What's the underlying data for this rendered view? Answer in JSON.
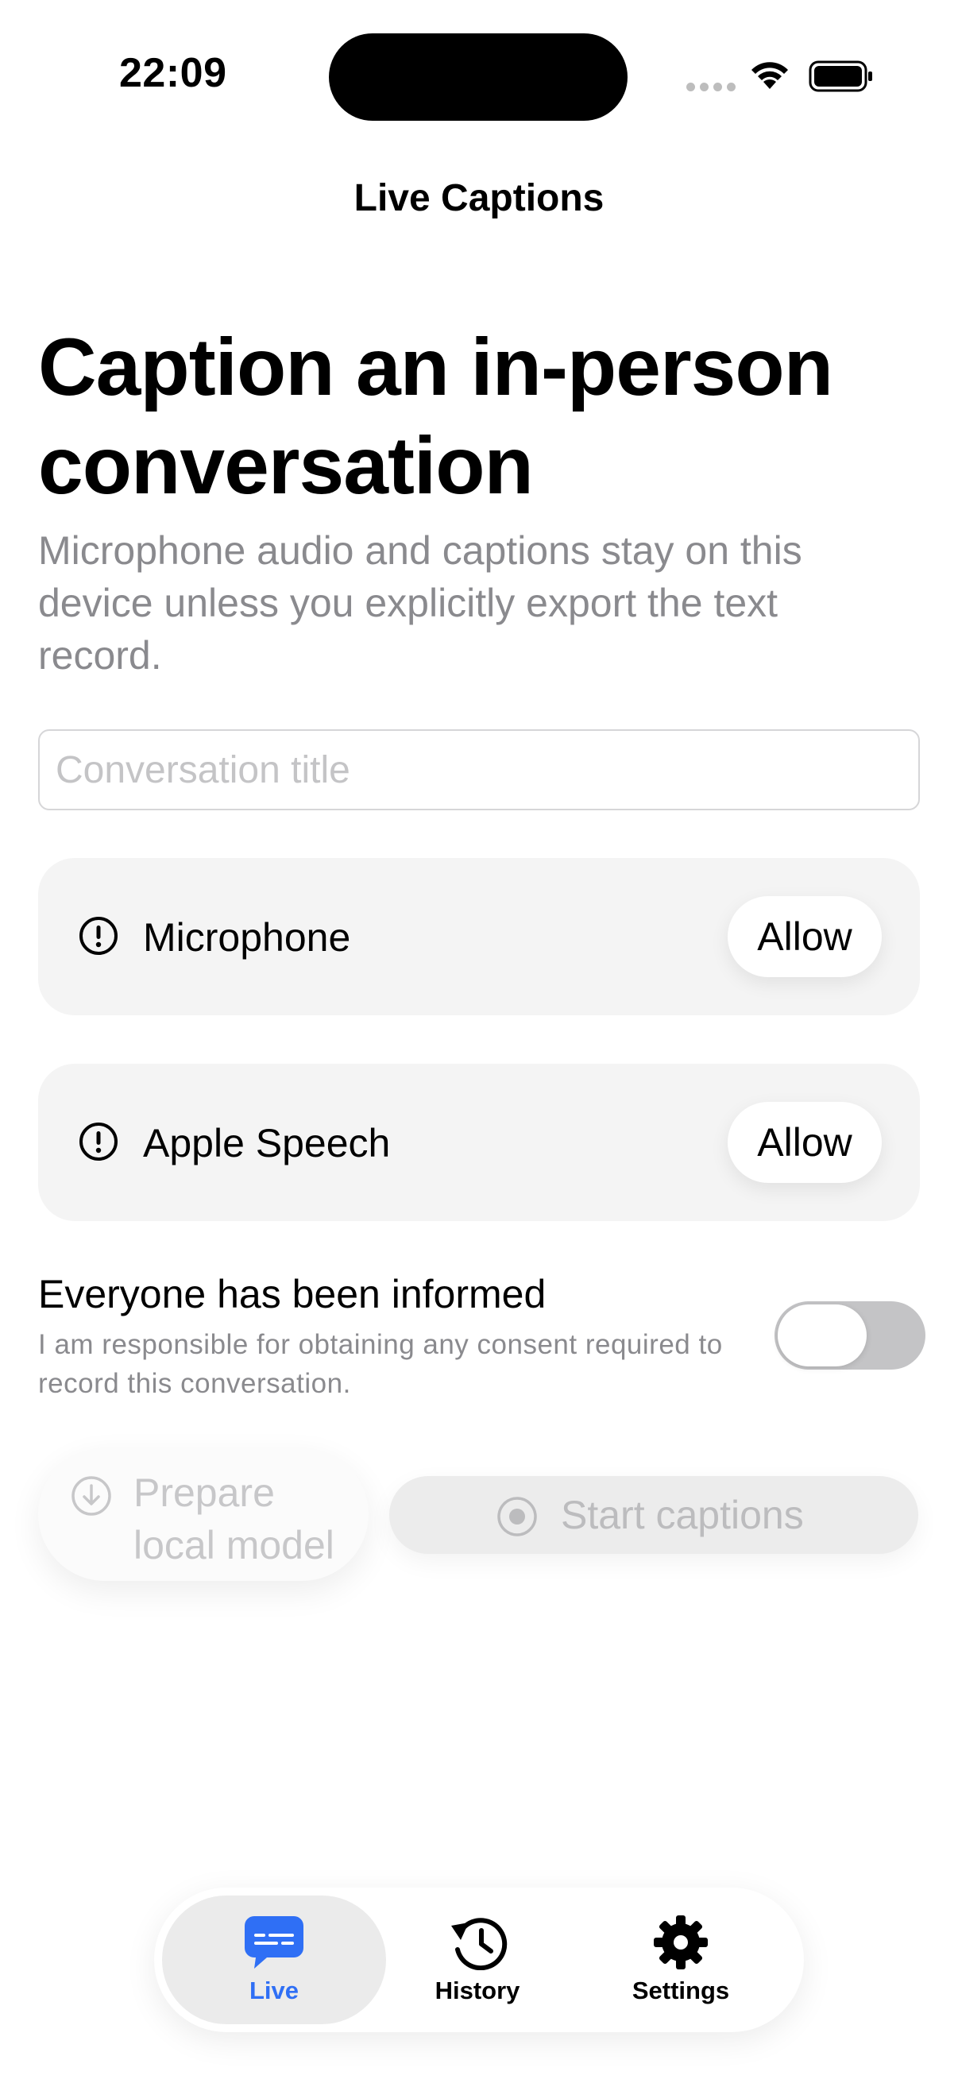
{
  "status_bar": {
    "time": "22:09",
    "icons": [
      "cellular-signal-icon",
      "wifi-icon",
      "battery-icon"
    ]
  },
  "nav": {
    "title": "Live Captions"
  },
  "hero": {
    "title": "Caption an in-person conversation",
    "subtitle": "Microphone audio and captions stay on this device unless you explicitly export the text record."
  },
  "title_input": {
    "value": "",
    "placeholder": "Conversation title"
  },
  "permissions": [
    {
      "label": "Microphone",
      "icon": "exclamation-circle-icon",
      "button": "Allow"
    },
    {
      "label": "Apple Speech",
      "icon": "exclamation-circle-icon",
      "button": "Allow"
    }
  ],
  "consent": {
    "title": "Everyone has been informed",
    "subtitle": "I am responsible for obtaining any consent required to record this conversation.",
    "toggle_on": false
  },
  "actions": {
    "prepare_label": "Prepare local model",
    "prepare_icon": "download-circle-icon",
    "start_label": "Start captions",
    "start_icon": "record-circle-icon"
  },
  "tabs": [
    {
      "label": "Live",
      "icon": "captions-bubble-icon",
      "active": true
    },
    {
      "label": "History",
      "icon": "history-clock-icon",
      "active": false
    },
    {
      "label": "Settings",
      "icon": "gear-icon",
      "active": false
    }
  ],
  "colors": {
    "accent": "#2f6ff5",
    "secondary_text": "#8a8a8e",
    "card_bg": "#f4f4f4",
    "disabled_text": "#c7c7c9"
  }
}
